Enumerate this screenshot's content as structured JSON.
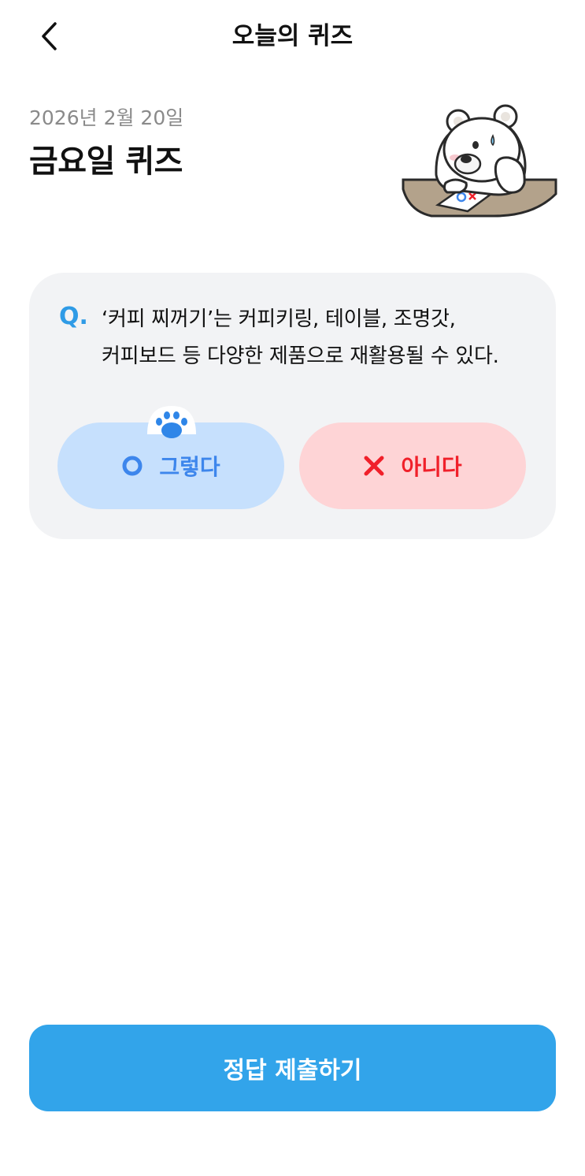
{
  "header": {
    "title": "오늘의 퀴즈",
    "back_icon": "chevron-left-icon"
  },
  "quiz": {
    "date": "2026년 2월 20일",
    "day_title": "금요일 퀴즈",
    "mascot_icon": "polar-bear-mascot-icon",
    "question_marker": "Q.",
    "question_line1": "‘커피 찌꺼기’는 커피키링, 테이블, 조명갓,",
    "question_line2": "커피보드 등 다양한 제품으로 재활용될 수 있다.",
    "options": [
      {
        "label": "그렇다",
        "icon": "circle-o-icon",
        "color": "#3d86ec",
        "bg": "#c6e0fd"
      },
      {
        "label": "아니다",
        "icon": "x-mark-icon",
        "color": "#f0202a",
        "bg": "#fed4d6"
      }
    ],
    "selected_indicator_icon": "paw-icon"
  },
  "submit": {
    "label": "정답 제출하기",
    "color": "#32a4ea"
  }
}
